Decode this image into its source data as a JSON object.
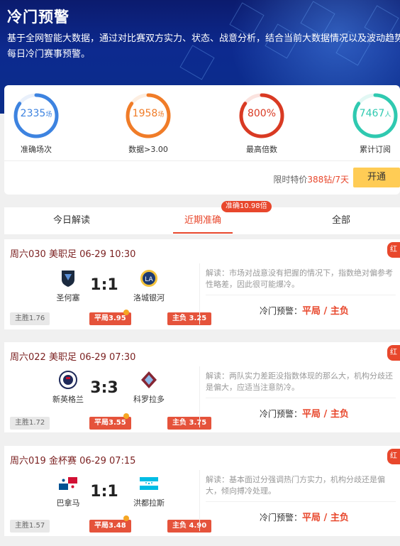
{
  "header": {
    "title": "冷门预警",
    "desc_line1": "基于全网智能大数据，通过对比赛双方实力、状态、战意分析，结合当前大数据情况以及波动趋势，提供",
    "desc_line2": "每日冷门赛事预警。"
  },
  "stats": [
    {
      "value": "2335",
      "unit": "场",
      "label": "准确场次",
      "color": "#3d83e0",
      "progress": 0.85
    },
    {
      "value": "1958",
      "unit": "场",
      "label": "数据>3.00",
      "color": "#f07c28",
      "progress": 0.85
    },
    {
      "value": "800%",
      "unit": "",
      "label": "最高倍数",
      "color": "#d93a23",
      "progress": 0.85
    },
    {
      "value": "7467",
      "unit": "人",
      "label": "累计订阅",
      "color": "#2fc9b0",
      "progress": 0.85
    }
  ],
  "promo": {
    "price_prefix": "限时特价",
    "price_value": "388钻/7天",
    "open_label": "开通"
  },
  "tabs": {
    "items": [
      "今日解读",
      "近期准确",
      "全部"
    ],
    "badge": "准确10.98倍"
  },
  "matches": [
    {
      "header": "周六030 美职足 06-29 10:30",
      "corner": "红",
      "home": "圣何塞",
      "away": "洛城银河",
      "score": "1:1",
      "home_odds": "主胜1.76",
      "draw_odds": "平局3.95",
      "away_odds": "主负 3.25",
      "analysis": "解读：市场对战意没有把握的情况下，指数绝对偏参考性略差，因此很可能爆冷。",
      "pred_label": "冷门预警：",
      "pred_value": "平局 / 主负"
    },
    {
      "header": "周六022 美职足 06-29 07:30",
      "corner": "红",
      "home": "新英格兰",
      "away": "科罗拉多",
      "score": "3:3",
      "home_odds": "主胜1.72",
      "draw_odds": "平局3.55",
      "away_odds": "主负 3.75",
      "analysis": "解读：两队实力差距没指数体现的那么大，机构分歧还是偏大，应适当注意防冷。",
      "pred_label": "冷门预警：",
      "pred_value": "平局 / 主负"
    },
    {
      "header": "周六019 金杯赛 06-29 07:15",
      "corner": "红",
      "home": "巴拿马",
      "away": "洪都拉斯",
      "score": "1:1",
      "home_odds": "主胜1.57",
      "draw_odds": "平局3.48",
      "away_odds": "主负 4.90",
      "analysis": "解读：基本面过分强调热门方实力，机构分歧还是偏大，倾向搏冷处理。",
      "pred_label": "冷门预警：",
      "pred_value": "平局 / 主负"
    }
  ]
}
